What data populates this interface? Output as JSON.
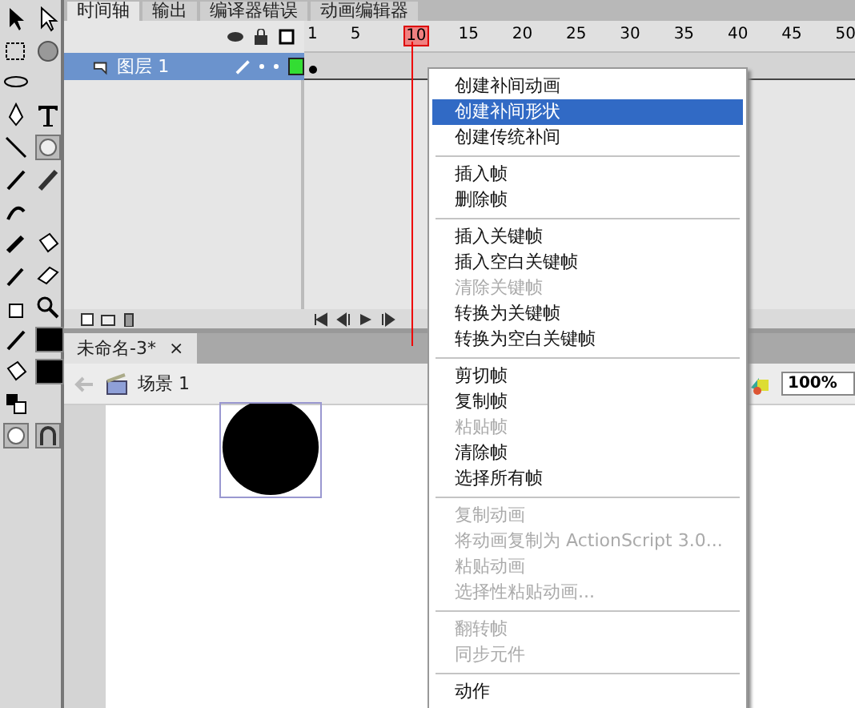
{
  "panel_tabs": [
    {
      "label": "时间轴",
      "selected": true
    },
    {
      "label": "输出",
      "selected": false
    },
    {
      "label": "编译器错误",
      "selected": false
    },
    {
      "label": "动画编辑器",
      "selected": false
    }
  ],
  "timeline": {
    "ruler": [
      {
        "text": "1",
        "current": false
      },
      {
        "text": "5",
        "current": false
      },
      {
        "text": "10",
        "current": true
      },
      {
        "text": "15",
        "current": false
      },
      {
        "text": "20",
        "current": false
      },
      {
        "text": "25",
        "current": false
      },
      {
        "text": "30",
        "current": false
      },
      {
        "text": "35",
        "current": false
      },
      {
        "text": "40",
        "current": false
      },
      {
        "text": "45",
        "current": false
      },
      {
        "text": "50",
        "current": false
      }
    ],
    "layers": [
      {
        "name": "图层 1",
        "selected": true,
        "color": "#33dd33"
      }
    ]
  },
  "document_tabs": [
    {
      "label": "未命名-3*",
      "selected": true,
      "close": "×"
    }
  ],
  "scene_bar": {
    "scene": "场景 1",
    "zoom": "100%"
  },
  "context_menu": [
    {
      "kind": "item",
      "label": "创建补间动画",
      "disabled": false,
      "selected": false
    },
    {
      "kind": "item",
      "label": "创建补间形状",
      "disabled": false,
      "selected": true
    },
    {
      "kind": "item",
      "label": "创建传统补间",
      "disabled": false,
      "selected": false
    },
    {
      "kind": "separator"
    },
    {
      "kind": "item",
      "label": "插入帧",
      "disabled": false,
      "selected": false
    },
    {
      "kind": "item",
      "label": "删除帧",
      "disabled": false,
      "selected": false
    },
    {
      "kind": "separator"
    },
    {
      "kind": "item",
      "label": "插入关键帧",
      "disabled": false,
      "selected": false
    },
    {
      "kind": "item",
      "label": "插入空白关键帧",
      "disabled": false,
      "selected": false
    },
    {
      "kind": "item",
      "label": "清除关键帧",
      "disabled": true,
      "selected": false
    },
    {
      "kind": "item",
      "label": "转换为关键帧",
      "disabled": false,
      "selected": false
    },
    {
      "kind": "item",
      "label": "转换为空白关键帧",
      "disabled": false,
      "selected": false
    },
    {
      "kind": "separator"
    },
    {
      "kind": "item",
      "label": "剪切帧",
      "disabled": false,
      "selected": false
    },
    {
      "kind": "item",
      "label": "复制帧",
      "disabled": false,
      "selected": false
    },
    {
      "kind": "item",
      "label": "粘贴帧",
      "disabled": true,
      "selected": false
    },
    {
      "kind": "item",
      "label": "清除帧",
      "disabled": false,
      "selected": false
    },
    {
      "kind": "item",
      "label": "选择所有帧",
      "disabled": false,
      "selected": false
    },
    {
      "kind": "separator"
    },
    {
      "kind": "item",
      "label": "复制动画",
      "disabled": true,
      "selected": false
    },
    {
      "kind": "item",
      "label": "将动画复制为 ActionScript 3.0...",
      "disabled": true,
      "selected": false
    },
    {
      "kind": "item",
      "label": "粘贴动画",
      "disabled": true,
      "selected": false
    },
    {
      "kind": "item",
      "label": "选择性粘贴动画...",
      "disabled": true,
      "selected": false
    },
    {
      "kind": "separator"
    },
    {
      "kind": "item",
      "label": "翻转帧",
      "disabled": true,
      "selected": false
    },
    {
      "kind": "item",
      "label": "同步元件",
      "disabled": true,
      "selected": false
    },
    {
      "kind": "separator"
    },
    {
      "kind": "item",
      "label": "动作",
      "disabled": false,
      "selected": false
    }
  ]
}
